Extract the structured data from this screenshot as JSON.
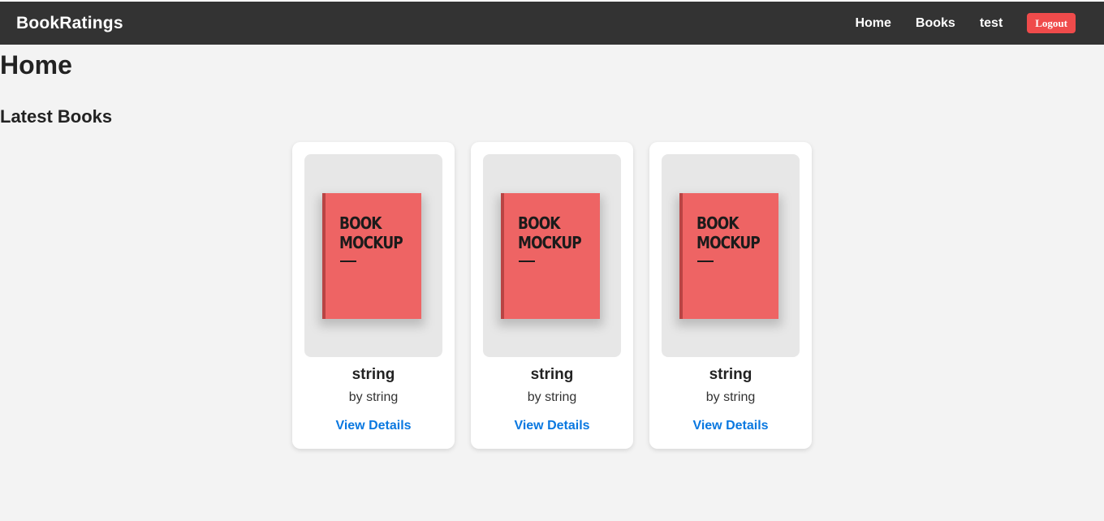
{
  "navbar": {
    "brand": "BookRatings",
    "links": [
      "Home",
      "Books",
      "test"
    ],
    "logout_label": "Logout"
  },
  "page": {
    "title": "Home",
    "section_title": "Latest Books"
  },
  "books": [
    {
      "cover_text": "BOOK\nMOCKUP",
      "title": "string",
      "author": "by string",
      "link": "View Details"
    },
    {
      "cover_text": "BOOK\nMOCKUP",
      "title": "string",
      "author": "by string",
      "link": "View Details"
    },
    {
      "cover_text": "BOOK\nMOCKUP",
      "title": "string",
      "author": "by string",
      "link": "View Details"
    }
  ],
  "colors": {
    "navbar_bg": "#333333",
    "page_bg": "#f3f3f3",
    "logout_bg": "#ef4b4b",
    "link": "#0a78e0",
    "book_cover": "#ee6464"
  }
}
